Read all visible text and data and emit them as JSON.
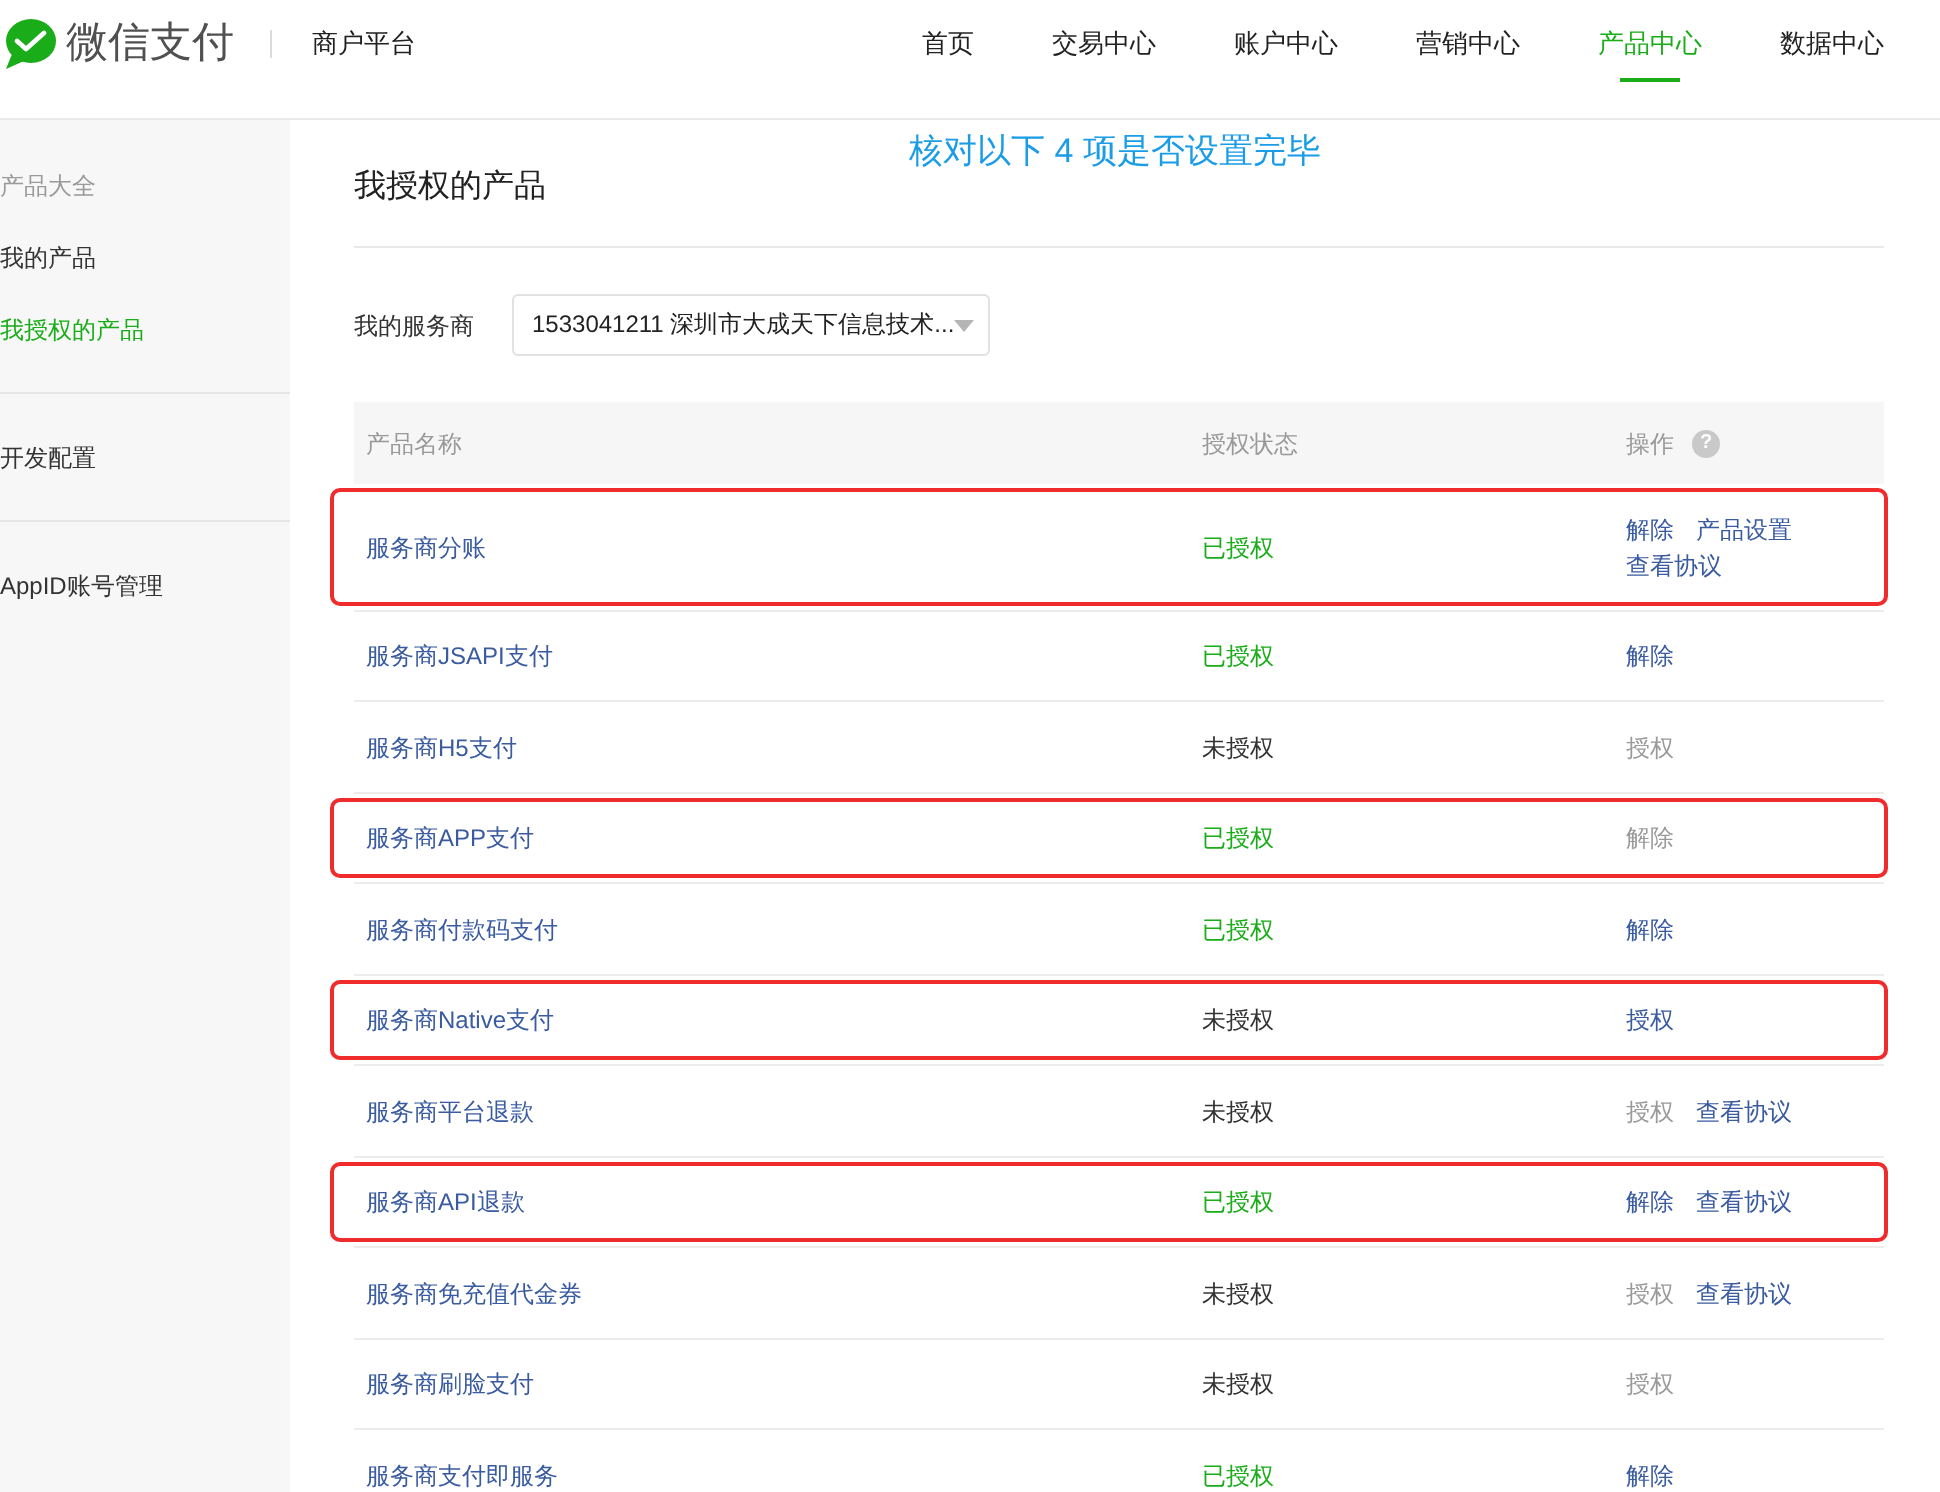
{
  "header": {
    "logo_text": "微信支付",
    "platform": "商户平台",
    "nav": [
      {
        "label": "首页",
        "selected": false
      },
      {
        "label": "交易中心",
        "selected": false
      },
      {
        "label": "账户中心",
        "selected": false
      },
      {
        "label": "营销中心",
        "selected": false
      },
      {
        "label": "产品中心",
        "selected": true
      },
      {
        "label": "数据中心",
        "selected": false
      }
    ]
  },
  "sidebar": {
    "sections": [
      {
        "title": "产品大全",
        "items": [
          {
            "label": "我的产品",
            "selected": false
          },
          {
            "label": "我授权的产品",
            "selected": true
          }
        ]
      },
      {
        "items": [
          {
            "label": "开发配置",
            "selected": false
          }
        ]
      },
      {
        "items": [
          {
            "label": "AppID账号管理",
            "selected": false
          }
        ]
      }
    ]
  },
  "annotation": {
    "text": "核对以下 4 项是否设置完毕"
  },
  "page": {
    "title": "我授权的产品",
    "filter": {
      "label": "我的服务商",
      "value": "1533041211 深圳市大成天下信息技术..."
    }
  },
  "table": {
    "columns": [
      {
        "label": "产品名称"
      },
      {
        "label": "授权状态"
      },
      {
        "label": "操作",
        "help": "?"
      }
    ],
    "rows": [
      {
        "name": "服务商分账",
        "status": "已授权",
        "authorized": true,
        "highlighted": true,
        "actions": [
          {
            "label": "解除",
            "disabled": false
          },
          {
            "label": "产品设置",
            "disabled": false
          },
          {
            "label": "查看协议",
            "disabled": false
          }
        ]
      },
      {
        "name": "服务商JSAPI支付",
        "status": "已授权",
        "authorized": true,
        "highlighted": false,
        "actions": [
          {
            "label": "解除",
            "disabled": false
          }
        ]
      },
      {
        "name": "服务商H5支付",
        "status": "未授权",
        "authorized": false,
        "highlighted": false,
        "actions": [
          {
            "label": "授权",
            "disabled": true
          }
        ]
      },
      {
        "name": "服务商APP支付",
        "status": "已授权",
        "authorized": true,
        "highlighted": true,
        "actions": [
          {
            "label": "解除",
            "disabled": true
          }
        ]
      },
      {
        "name": "服务商付款码支付",
        "status": "已授权",
        "authorized": true,
        "highlighted": false,
        "actions": [
          {
            "label": "解除",
            "disabled": false
          }
        ]
      },
      {
        "name": "服务商Native支付",
        "status": "未授权",
        "authorized": false,
        "highlighted": true,
        "actions": [
          {
            "label": "授权",
            "disabled": false
          }
        ]
      },
      {
        "name": "服务商平台退款",
        "status": "未授权",
        "authorized": false,
        "highlighted": false,
        "actions": [
          {
            "label": "授权",
            "disabled": true
          },
          {
            "label": "查看协议",
            "disabled": false
          }
        ]
      },
      {
        "name": "服务商API退款",
        "status": "已授权",
        "authorized": true,
        "highlighted": true,
        "actions": [
          {
            "label": "解除",
            "disabled": false
          },
          {
            "label": "查看协议",
            "disabled": false
          }
        ]
      },
      {
        "name": "服务商免充值代金券",
        "status": "未授权",
        "authorized": false,
        "highlighted": false,
        "actions": [
          {
            "label": "授权",
            "disabled": true
          },
          {
            "label": "查看协议",
            "disabled": false
          }
        ]
      },
      {
        "name": "服务商刷脸支付",
        "status": "未授权",
        "authorized": false,
        "highlighted": false,
        "actions": [
          {
            "label": "授权",
            "disabled": true
          }
        ]
      },
      {
        "name": "服务商支付即服务",
        "status": "已授权",
        "authorized": true,
        "highlighted": false,
        "actions": [
          {
            "label": "解除",
            "disabled": false
          }
        ]
      }
    ]
  }
}
